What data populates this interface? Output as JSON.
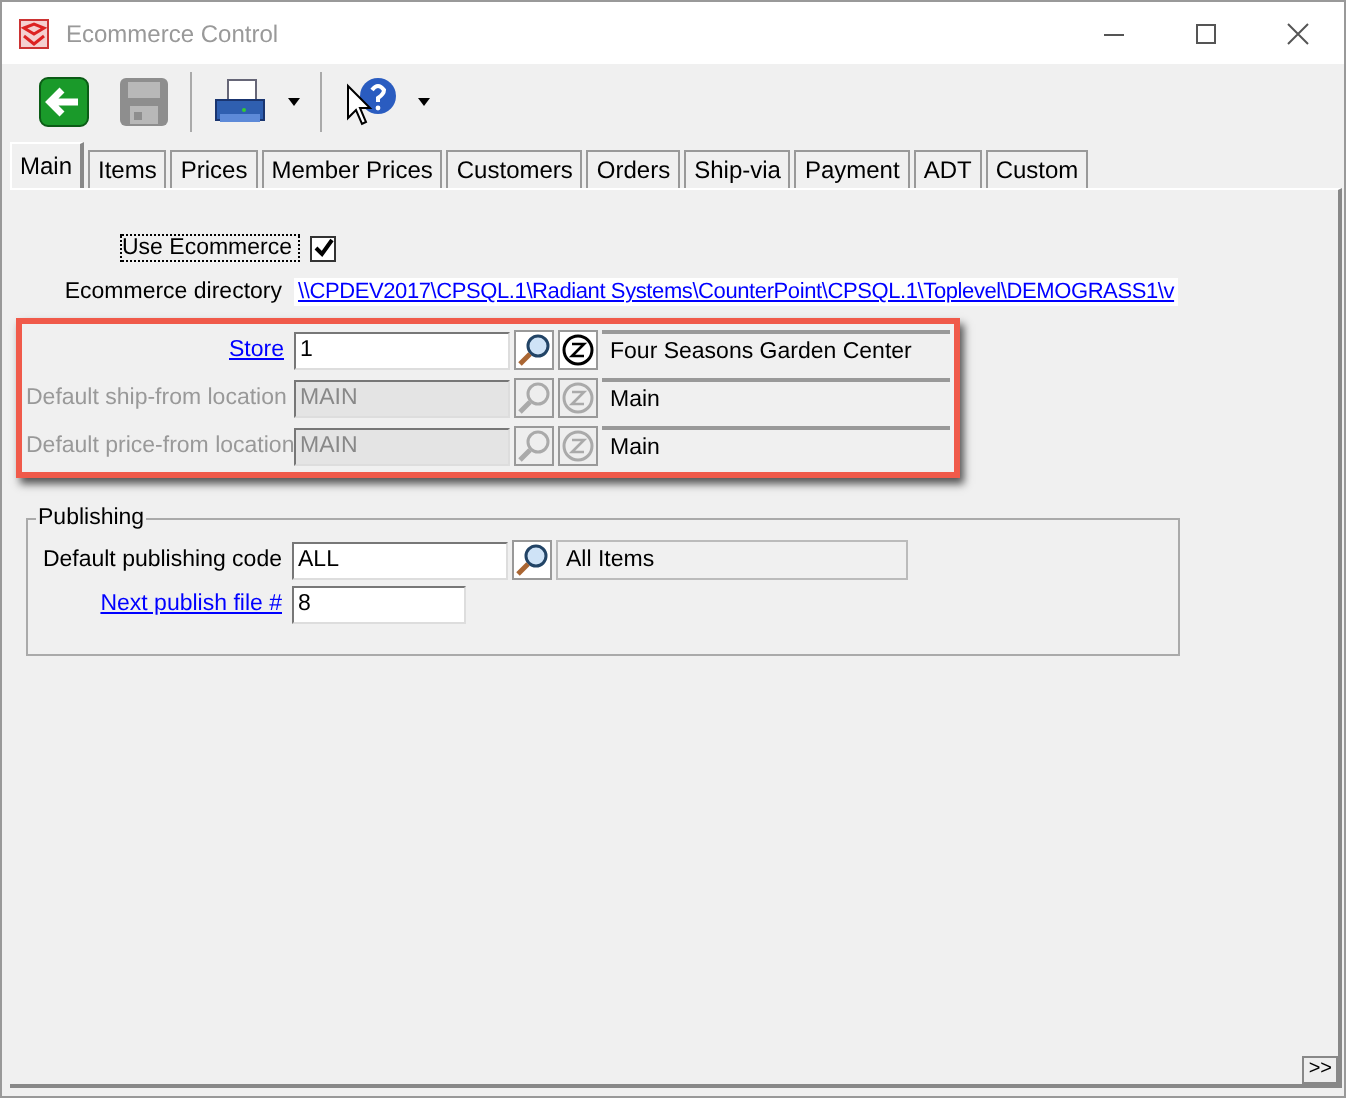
{
  "window": {
    "title": "Ecommerce Control"
  },
  "tabs": [
    {
      "label": "Main",
      "selected": true
    },
    {
      "label": "Items",
      "selected": false
    },
    {
      "label": "Prices",
      "selected": false
    },
    {
      "label": "Member Prices",
      "selected": false
    },
    {
      "label": "Customers",
      "selected": false
    },
    {
      "label": "Orders",
      "selected": false
    },
    {
      "label": "Ship-via",
      "selected": false
    },
    {
      "label": "Payment",
      "selected": false
    },
    {
      "label": "ADT",
      "selected": false
    },
    {
      "label": "Custom",
      "selected": false
    }
  ],
  "use_ecommerce": {
    "label": "Use Ecommerce",
    "checked": true
  },
  "directory": {
    "label": "Ecommerce directory",
    "value": "\\\\CPDEV2017\\CPSQL.1\\Radiant Systems\\CounterPoint\\CPSQL.1\\Toplevel\\DEMOGRASS1\\v"
  },
  "location_fields": [
    {
      "label": "Store",
      "link": true,
      "disabled": false,
      "value": "1",
      "description": "Four Seasons Garden Center"
    },
    {
      "label": "Default ship-from location",
      "link": false,
      "disabled": true,
      "value": "MAIN",
      "description": "Main"
    },
    {
      "label": "Default price-from location",
      "link": false,
      "disabled": true,
      "value": "MAIN",
      "description": "Main"
    }
  ],
  "publishing": {
    "title": "Publishing",
    "code": {
      "label": "Default publishing code",
      "value": "ALL",
      "description": "All Items"
    },
    "next_file": {
      "label": "Next publish file #",
      "value": "8"
    }
  },
  "more_button": ">>"
}
